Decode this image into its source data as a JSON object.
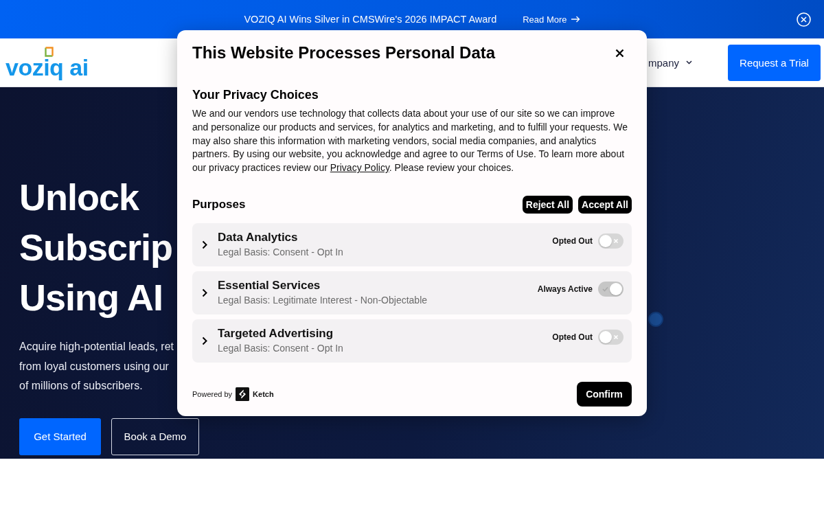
{
  "banner": {
    "text": "VOZIQ AI Wins Silver in CMSWire's 2026 IMPACT Award",
    "link": "Read More"
  },
  "header": {
    "logo": "voziq ai",
    "nav": [
      {
        "label": "mpany"
      }
    ],
    "cta": "Request a Trial"
  },
  "hero": {
    "headline_lines": [
      "Unlock",
      "Subscrip",
      "Using AI"
    ],
    "subtitle_lines": [
      "Acquire high-potential leads, ret",
      "from loyal customers using our",
      "of millions of subscribers."
    ],
    "buttons": [
      {
        "label": "Get Started",
        "kind": "primary"
      },
      {
        "label": "Book a Demo",
        "kind": "outline"
      }
    ]
  },
  "consent_dialog": {
    "title": "This Website Processes Personal Data",
    "section_title": "Your Privacy Choices",
    "notice": {
      "text_before": "We and our vendors use technology that collects data about your use of our site so we can improve and personalize our products and services, for analytics and marketing, and to fulfill your requests. We may also share this information with marketing vendors, social media companies, and analytics partners. By using our website, you acknowledge and agree to our Terms of Use. To learn more about our privacy practices review our ",
      "link": "Privacy Policy",
      "text_after": ". Please review your choices."
    },
    "purposes_title": "Purposes",
    "bulk_buttons": [
      "Reject All",
      "Accept All"
    ],
    "purposes": [
      {
        "title": "Data Analytics",
        "legal_basis": "Legal Basis: Consent - Opt In",
        "status": "Opted Out",
        "on": false,
        "disabled": false,
        "expanded": false
      },
      {
        "title": "Essential Services",
        "legal_basis": "Legal Basis: Legitimate Interest - Non-Objectable",
        "status": "Always Active",
        "on": true,
        "disabled": true,
        "expanded": false
      },
      {
        "title": "Targeted Advertising",
        "legal_basis": "Legal Basis: Consent - Opt In",
        "status": "Opted Out",
        "on": false,
        "disabled": false,
        "expanded": false
      }
    ],
    "footer": {
      "powered_by": "Powered by",
      "brand": "Ketch",
      "confirm": "Confirm"
    }
  }
}
